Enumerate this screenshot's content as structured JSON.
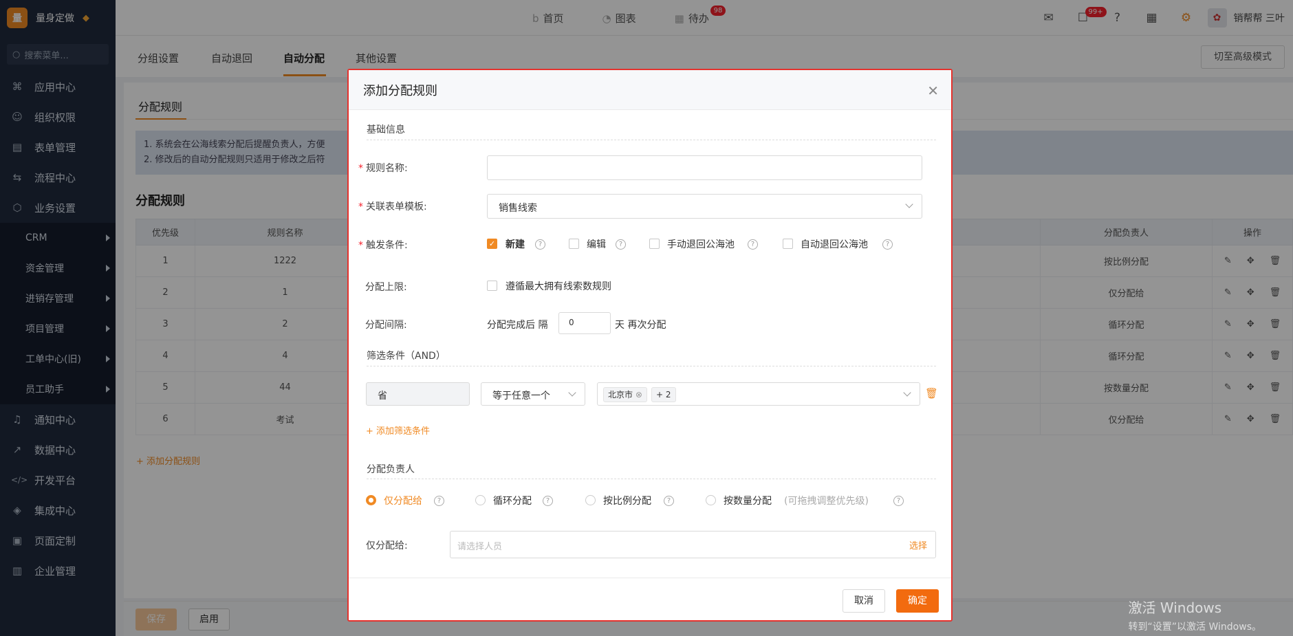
{
  "brand": {
    "logo": "量",
    "name": "量身定做"
  },
  "sidebar": {
    "search_placeholder": "搜索菜单...",
    "items_top": [
      {
        "label": "应用中心",
        "icon": "⌘"
      },
      {
        "label": "组织权限",
        "icon": "👤"
      },
      {
        "label": "表单管理",
        "icon": "▤"
      },
      {
        "label": "流程中心",
        "icon": "⇆"
      },
      {
        "label": "业务设置",
        "icon": "⬡"
      }
    ],
    "sub_items": [
      "CRM",
      "资金管理",
      "进销存管理",
      "项目管理",
      "工单中心(旧)",
      "员工助手"
    ],
    "items_bottom": [
      {
        "label": "通知中心",
        "icon": "🔔"
      },
      {
        "label": "数据中心",
        "icon": "📈"
      },
      {
        "label": "开发平台",
        "icon": "</>"
      },
      {
        "label": "集成中心",
        "icon": "◈"
      },
      {
        "label": "页面定制",
        "icon": "▣"
      },
      {
        "label": "企业管理",
        "icon": "▥"
      }
    ]
  },
  "topnav": {
    "home": "首页",
    "charts": "图表",
    "todo": "待办",
    "todo_badge": "98",
    "msg_badge": "99+",
    "user": "销帮帮 三叶"
  },
  "page_tabs": {
    "t1": "分组设置",
    "t2": "自动退回",
    "t3": "自动分配",
    "t4": "其他设置",
    "advanced": "切至高级模式"
  },
  "content": {
    "sec_tab": "分配规则",
    "notice1": "1. 系统会在公海线索分配后提醒负责人，方便",
    "notice2": "2. 修改后的自动分配规则只适用于修改之后符",
    "table_title": "分配规则",
    "headers": {
      "priority": "优先级",
      "name": "规则名称",
      "owner": "分配负责人",
      "ops": "操作"
    },
    "rows": [
      {
        "p": "1",
        "n": "1222",
        "o": "按比例分配"
      },
      {
        "p": "2",
        "n": "1",
        "o": "仅分配给"
      },
      {
        "p": "3",
        "n": "2",
        "o": "循环分配"
      },
      {
        "p": "4",
        "n": "4",
        "o": "循环分配"
      },
      {
        "p": "5",
        "n": "44",
        "o": "按数量分配"
      },
      {
        "p": "6",
        "n": "考试",
        "o": "仅分配给"
      }
    ],
    "add_rule": "+ 添加分配规则",
    "save": "保存",
    "enable": "启用"
  },
  "modal": {
    "title": "添加分配规则",
    "basic": "基础信息",
    "rule_name_label": "规则名称:",
    "rule_name_value": "",
    "template_label": "关联表单模板:",
    "template_value": "销售线索",
    "trigger_label": "触发条件:",
    "trigger_opts": [
      "新建",
      "编辑",
      "手动退回公海池",
      "自动退回公海池"
    ],
    "limit_label": "分配上限:",
    "limit_opt": "遵循最大拥有线索数规则",
    "interval_label": "分配间隔:",
    "interval_prefix": "分配完成后 隔",
    "interval_value": "0",
    "interval_suffix": "天 再次分配",
    "filter_title": "筛选条件（AND）",
    "filter_field": "省",
    "filter_op": "等于任意一个",
    "filter_tag": "北京市",
    "filter_more": "+ 2",
    "add_filter": "+ 添加筛选条件",
    "owner_title": "分配负责人",
    "owner_opts": [
      "仅分配给",
      "循环分配",
      "按比例分配",
      "按数量分配"
    ],
    "owner_hint": "(可拖拽调整优先级)",
    "assign_label": "仅分配给:",
    "assign_placeholder": "请选择人员",
    "assign_select": "选择",
    "cancel": "取消",
    "ok": "确定"
  },
  "watermark": {
    "line1": "激活 Windows",
    "line2": "转到“设置”以激活 Windows。"
  },
  "colors": {
    "accent": "#f08a24",
    "sidebar": "#1f2a3d",
    "danger": "#f5222d"
  }
}
